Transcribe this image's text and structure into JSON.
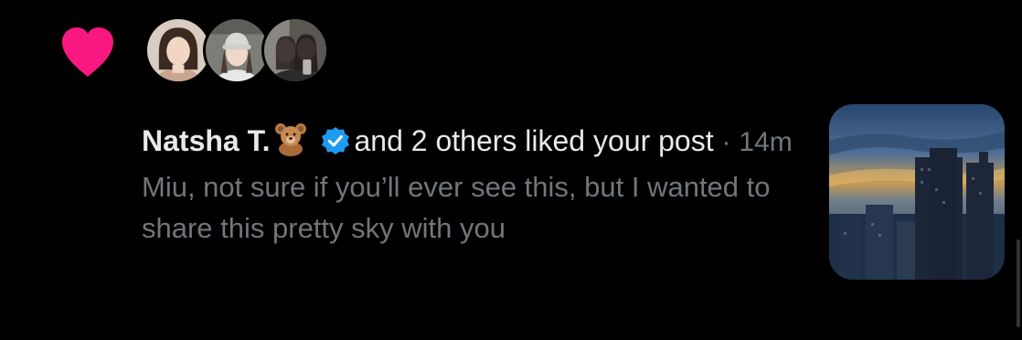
{
  "notification": {
    "type_icon": "heart-icon",
    "heart_color": "#f91880",
    "avatars": [
      {
        "name": "avatar-natsha"
      },
      {
        "name": "avatar-liker-2"
      },
      {
        "name": "avatar-liker-3"
      }
    ],
    "username": "Natsha T.",
    "username_emoji": "bear-icon",
    "verified_icon": "verified-badge-icon",
    "verified_color": "#1d9bf0",
    "action_text": "and 2 others liked your post",
    "separator": "·",
    "time": "14m",
    "post_text": "Miu, not sure if you’ll ever see this, but I wanted to share this pretty sky with you",
    "thumbnail": "sunset-sky-photo"
  },
  "colors": {
    "background": "#000000",
    "primary_text": "#e7e9ea",
    "secondary_text": "#71767b"
  }
}
